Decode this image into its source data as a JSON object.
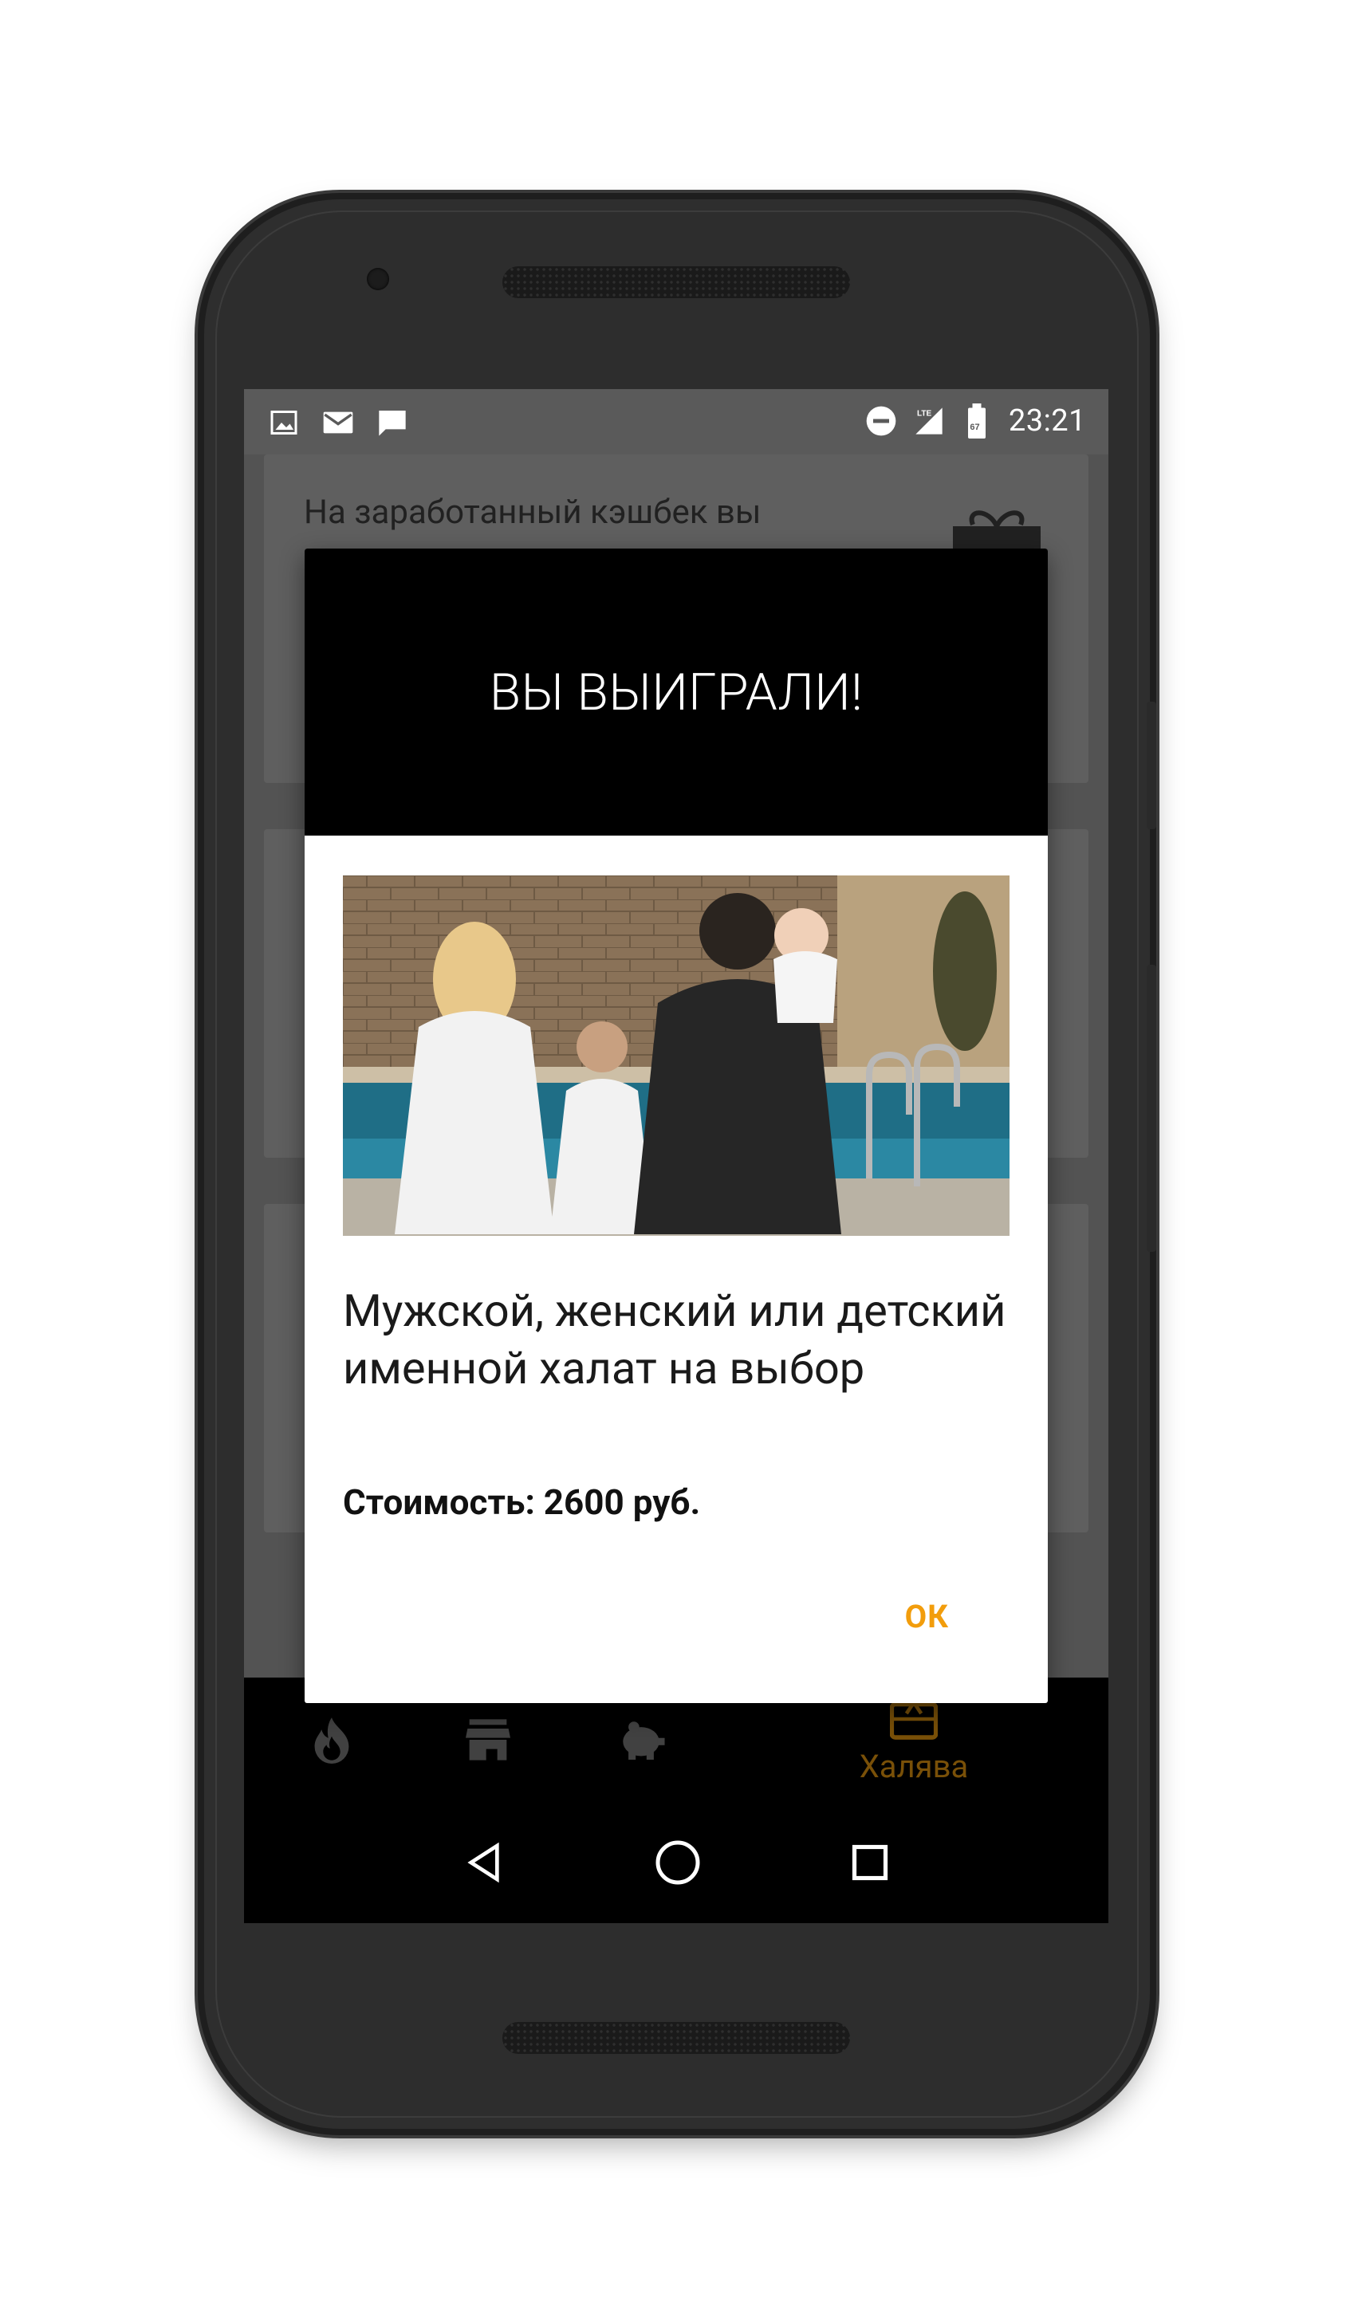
{
  "status_bar": {
    "time": "23:21",
    "icons_left": [
      "image-icon",
      "mail-icon",
      "chat-icon"
    ],
    "icons_right": [
      "do-not-disturb-icon",
      "lte-signal-icon",
      "battery-icon"
    ],
    "network": "LTE",
    "battery_level": "67"
  },
  "background": {
    "card1_text": "На заработанный кэшбек вы"
  },
  "dialog": {
    "title": "ВЫ ВЫИГРАЛИ!",
    "image_alt": "prize-photo",
    "prize_name": "Мужской, женский или детский именной халат на выбор",
    "price": "Стоимость: 2600 руб.",
    "ok_label": "ОК"
  },
  "bottom_nav": {
    "items": [
      {
        "icon": "flame-icon",
        "label": ""
      },
      {
        "icon": "store-icon",
        "label": ""
      },
      {
        "icon": "piggy-bank-icon",
        "label": ""
      },
      {
        "icon": "ticket-icon",
        "label": "Халява",
        "active": true
      }
    ]
  },
  "system_nav": {
    "icons": [
      "back-icon",
      "home-icon",
      "recents-icon"
    ]
  },
  "colors": {
    "accent": "#f29d0c",
    "dialog_header": "#000000",
    "status_bar": "#5a5a5a"
  }
}
